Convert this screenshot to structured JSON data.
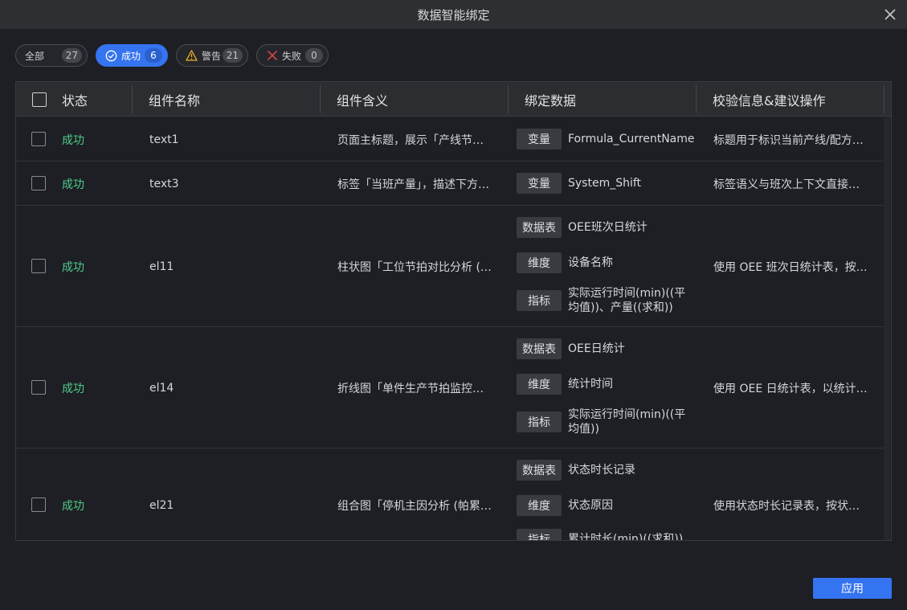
{
  "dialog": {
    "title": "数据智能绑定"
  },
  "filters": [
    {
      "label": "全部",
      "count": "27",
      "icon": "none",
      "active": false
    },
    {
      "label": "成功",
      "count": "6",
      "icon": "check-circle-icon",
      "active": true
    },
    {
      "label": "警告",
      "count": "21",
      "icon": "warning-icon",
      "active": false
    },
    {
      "label": "失败",
      "count": "0",
      "icon": "x-icon",
      "active": false
    }
  ],
  "table": {
    "headers": [
      "状态",
      "组件名称",
      "组件含义",
      "绑定数据",
      "校验信息&建议操作"
    ],
    "rows": [
      {
        "status": "成功",
        "name": "text1",
        "meaning": "页面主标题，展示「产线节…",
        "bindings": [
          {
            "tag": "变量",
            "value": "Formula_CurrentName"
          }
        ],
        "advice": "标题用于标识当前产线/配方…"
      },
      {
        "status": "成功",
        "name": "text3",
        "meaning": "标签「当班产量」，描述下方…",
        "bindings": [
          {
            "tag": "变量",
            "value": "System_Shift"
          }
        ],
        "advice": "标签语义与班次上下文直接…"
      },
      {
        "status": "成功",
        "name": "el11",
        "meaning": "柱状图「工位节拍对比分析 (…",
        "bindings": [
          {
            "tag": "数据表",
            "value": "OEE班次日统计"
          },
          {
            "tag": "维度",
            "value": "设备名称"
          },
          {
            "tag": "指标",
            "value": "实际运行时间(min)((平均值))、产量((求和))"
          }
        ],
        "advice": "使用 OEE 班次日统计表，按…"
      },
      {
        "status": "成功",
        "name": "el14",
        "meaning": "折线图「单件生产节拍监控…",
        "bindings": [
          {
            "tag": "数据表",
            "value": "OEE日统计"
          },
          {
            "tag": "维度",
            "value": "统计时间"
          },
          {
            "tag": "指标",
            "value": "实际运行时间(min)((平均值))"
          }
        ],
        "advice": "使用 OEE 日统计表，以统计…"
      },
      {
        "status": "成功",
        "name": "el21",
        "meaning": "组合图「停机主因分析 (帕累…",
        "bindings": [
          {
            "tag": "数据表",
            "value": "状态时长记录"
          },
          {
            "tag": "维度",
            "value": "状态原因"
          },
          {
            "tag": "指标",
            "value": "累计时长(min)((求和))"
          }
        ],
        "advice": "使用状态时长记录表，按状…"
      }
    ]
  },
  "footer": {
    "apply_label": "应用"
  },
  "colors": {
    "accent": "#3574f0",
    "success": "#4ecb8a",
    "warning": "#f0b429",
    "error": "#e5484d"
  }
}
